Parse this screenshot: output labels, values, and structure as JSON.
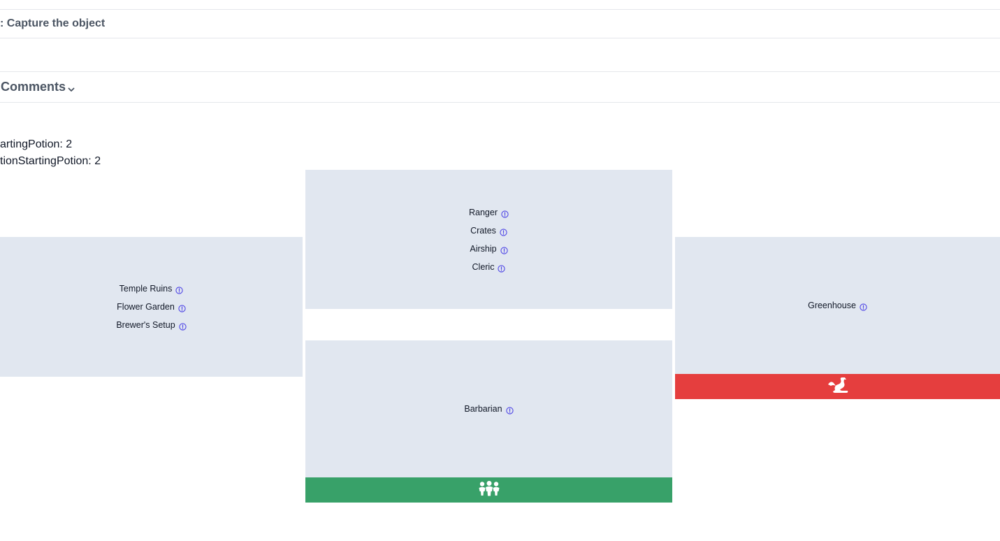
{
  "header": {
    "title": ": Capture the object",
    "comments_label": "Comments"
  },
  "meta": {
    "line1": "artingPotion: 2",
    "line2": "tionStartingPotion: 2"
  },
  "panels": {
    "left": {
      "items": [
        {
          "label": "Temple Ruins"
        },
        {
          "label": "Flower Garden"
        },
        {
          "label": "Brewer's Setup"
        }
      ]
    },
    "top_center": {
      "items": [
        {
          "label": "Ranger"
        },
        {
          "label": "Crates"
        },
        {
          "label": "Airship"
        },
        {
          "label": "Cleric"
        }
      ]
    },
    "bottom_center": {
      "items": [
        {
          "label": "Barbarian"
        }
      ],
      "footer": {
        "icon": "people-group-icon",
        "color": "#38a169"
      }
    },
    "right": {
      "items": [
        {
          "label": "Greenhouse"
        }
      ],
      "footer": {
        "icon": "dragon-icon",
        "color": "#e53e3e"
      }
    }
  },
  "colors": {
    "panel_bg": "#e1e7f0",
    "info_icon": "#4f46e5",
    "green": "#38a169",
    "red": "#e53e3e"
  }
}
